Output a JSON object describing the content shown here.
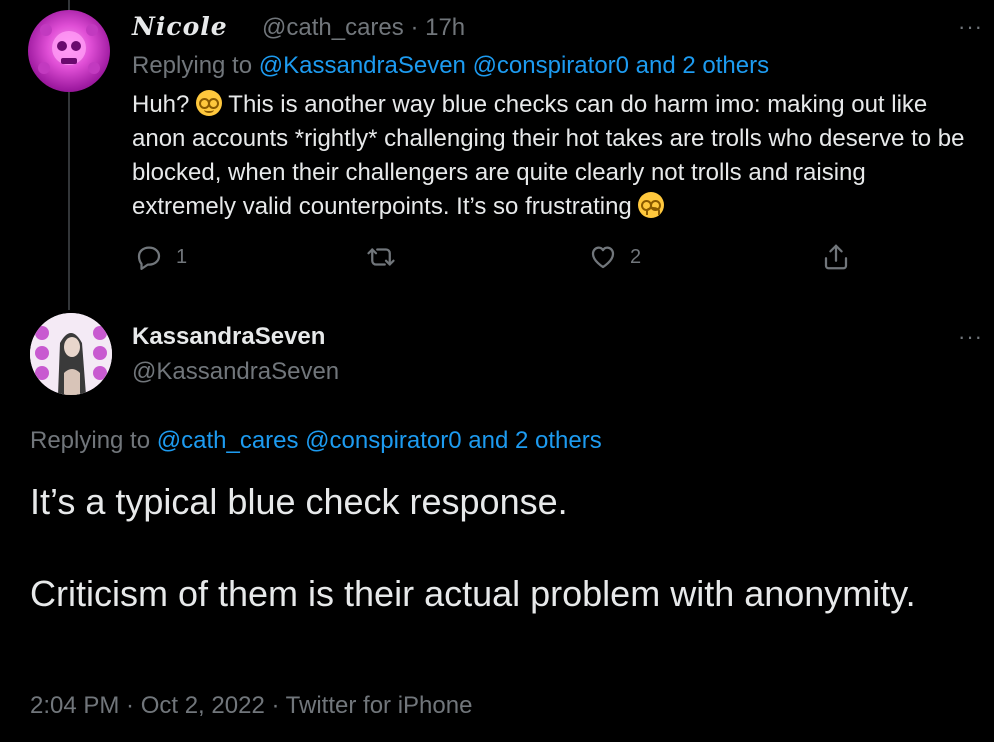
{
  "tweet1": {
    "display_name": "Nicole",
    "handle": "@cath_cares",
    "time": "· 17h",
    "replying_prefix": "Replying to",
    "replying_mentions": "@KassandraSeven @conspirator0 and 2 others",
    "text_before_emoji": "Huh?",
    "text_after_emoji": "This is another way blue checks can do harm imo: making out like anon accounts *rightly* challenging their hot takes are trolls who deserve to be blocked, when their challengers are quite clearly not trolls and raising extremely valid counterpoints. It’s so frustrating",
    "reply_count": "1",
    "like_count": "2",
    "more_label": "···"
  },
  "tweet2": {
    "display_name": "KassandraSeven",
    "handle": "@KassandraSeven",
    "more_label": "···",
    "replying_prefix": "Replying to",
    "replying_mentions": "@cath_cares @conspirator0 and 2 others",
    "text_line1": "It’s a typical blue check response.",
    "text_line2": "Criticism of them is their actual problem with anonymity.",
    "timestamp": "2:04 PM · Oct 2, 2022 · Twitter for iPhone"
  },
  "icons": {
    "reply": "reply-icon",
    "retweet": "retweet-icon",
    "like": "like-icon",
    "share": "share-icon",
    "more": "more-icon"
  },
  "colors": {
    "background": "#000000",
    "text": "#e7e9ea",
    "muted": "#71767b",
    "link": "#1d9bf0"
  }
}
